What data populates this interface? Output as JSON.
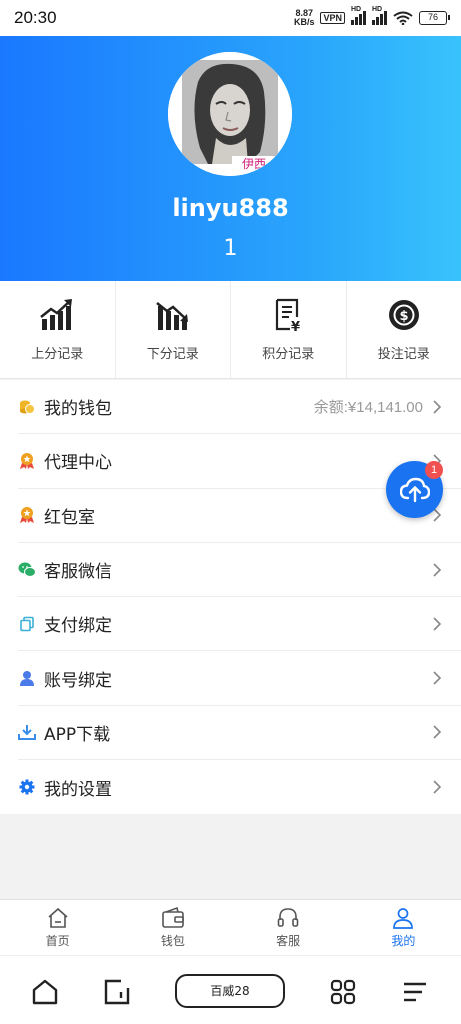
{
  "status_bar": {
    "time": "20:30",
    "net_speed_value": "8.87",
    "net_speed_unit": "KB/s",
    "vpn": "VPN",
    "hd": "HD",
    "battery": "76"
  },
  "profile": {
    "username": "linyu888",
    "level": "1",
    "avatar_text": "伊西"
  },
  "quick_actions": [
    {
      "label": "上分记录",
      "icon": "chart-up-icon"
    },
    {
      "label": "下分记录",
      "icon": "chart-down-icon"
    },
    {
      "label": "积分记录",
      "icon": "receipt-yen-icon"
    },
    {
      "label": "投注记录",
      "icon": "dollar-coin-icon"
    }
  ],
  "menu": [
    {
      "label": "我的钱包",
      "value": "余额:¥14,141.00",
      "icon": "coins-icon",
      "color": "#f0b429"
    },
    {
      "label": "代理中心",
      "icon": "medal-icon",
      "color": "#f0a020"
    },
    {
      "label": "红包室",
      "icon": "medal-icon",
      "color": "#f0a020"
    },
    {
      "label": "客服微信",
      "icon": "wechat-icon",
      "color": "#2aae67"
    },
    {
      "label": "支付绑定",
      "icon": "copy-icon",
      "color": "#3ab0d8"
    },
    {
      "label": "账号绑定",
      "icon": "user-icon",
      "color": "#4a7be8"
    },
    {
      "label": "APP下载",
      "icon": "download-icon",
      "color": "#3a8de8"
    },
    {
      "label": "我的设置",
      "icon": "gear-icon",
      "color": "#1a73f0"
    }
  ],
  "fab": {
    "badge": "1",
    "icon": "cloud-upload-icon"
  },
  "tabs": [
    {
      "label": "首页",
      "icon": "home-icon",
      "active": false
    },
    {
      "label": "钱包",
      "icon": "wallet-icon",
      "active": false
    },
    {
      "label": "客服",
      "icon": "headset-icon",
      "active": false
    },
    {
      "label": "我的",
      "icon": "user-icon",
      "active": true
    }
  ],
  "system_nav": {
    "pill_label": "百威28"
  },
  "colors": {
    "accent": "#1a73f0",
    "header_start": "#1a78ff",
    "header_end": "#38c3fc",
    "badge": "#f05050"
  }
}
